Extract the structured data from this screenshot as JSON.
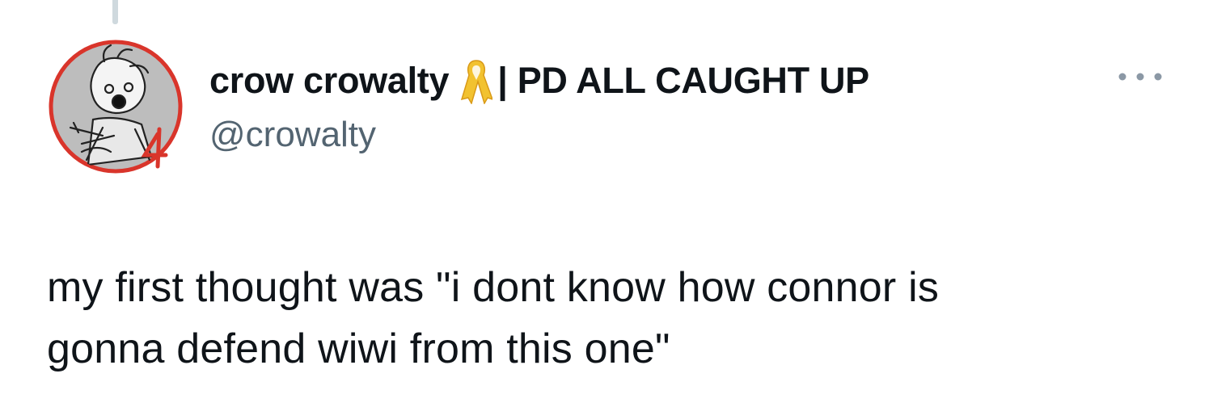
{
  "tweet": {
    "author": {
      "display_name": "crow crowalty",
      "name_suffix": "| PD ALL CAUGHT UP",
      "handle": "@crowalty",
      "badge_icon": "yellow-ribbon-icon",
      "avatar_border_color": "#d9352b"
    },
    "text_lines": [
      "my first thought was \"i dont know how connor is",
      "gonna defend wiwi from this one\""
    ],
    "more_icon": "more-options-icon"
  }
}
